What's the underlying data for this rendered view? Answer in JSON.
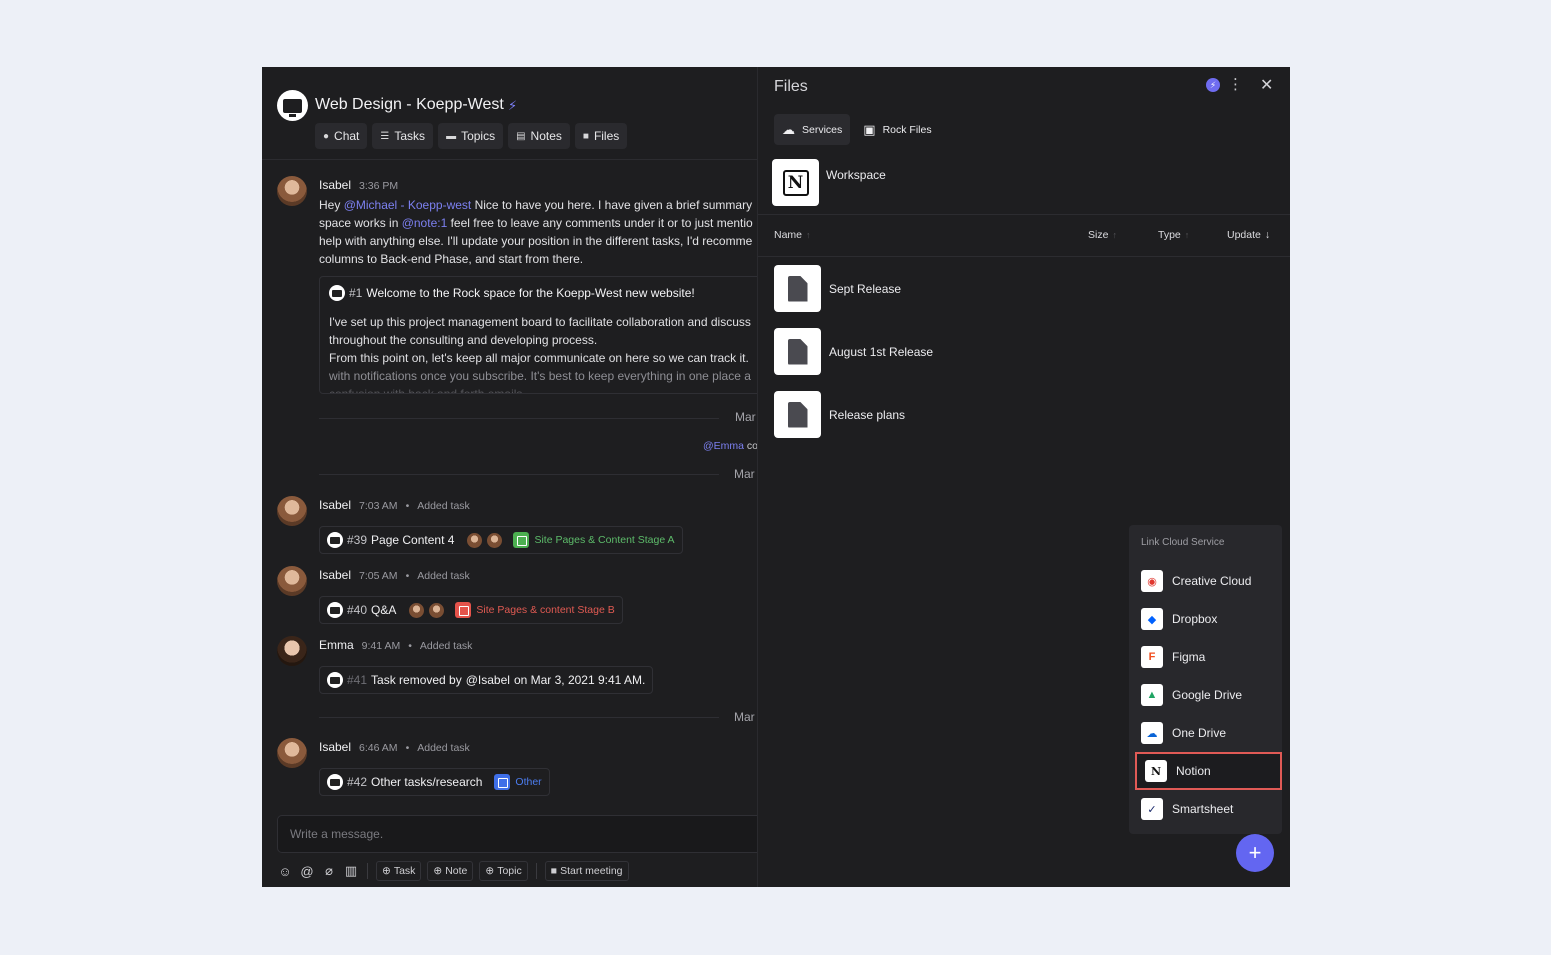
{
  "space": {
    "title": "Web Design - Koepp-West",
    "tabs": [
      {
        "label": "Chat",
        "icon": "chat-bubble-icon"
      },
      {
        "label": "Tasks",
        "icon": "tasks-icon"
      },
      {
        "label": "Topics",
        "icon": "topics-icon"
      },
      {
        "label": "Notes",
        "icon": "notes-icon"
      },
      {
        "label": "Files",
        "icon": "folder-icon"
      }
    ]
  },
  "messages": {
    "m1": {
      "name": "Isabel",
      "time": "3:36 PM",
      "line1_pre": "Hey ",
      "line1_mention": "@Michael - Koepp-west",
      "line1_post": "  Nice to have you here. I have given a brief summary",
      "line2_pre": "space works in ",
      "line2_mention": "@note:1",
      "line2_post": " feel free to leave any comments under it or to just mentio",
      "line3": "help with anything else. I'll update your position in the different tasks, I'd recomme",
      "line4": "columns to Back-end Phase, and start from there.",
      "card_num": "#1",
      "card_title": "Welcome to the Rock space for the Koepp-West new website!",
      "card_line1": "I've set up this project management board to facilitate collaboration and discuss",
      "card_line2": "throughout the consulting and developing process.",
      "card_line3": "From this point on, let's keep all major communicate on here so we can track it.",
      "card_line4": "with notifications once you subscribe. It's best to keep everything in one place a",
      "card_line5": "confusion with back and forth emails."
    },
    "date1": "Mar",
    "emma_mention": "@Emma",
    "emma_after": " co",
    "date2": "Mar",
    "m2": {
      "name": "Isabel",
      "time": "7:03 AM",
      "action": "Added task",
      "num": "#39",
      "task": "Page Content 4",
      "stage": "Site Pages & Content Stage A"
    },
    "m3": {
      "name": "Isabel",
      "time": "7:05 AM",
      "action": "Added task",
      "num": "#40",
      "task": "Q&A",
      "stage": "Site Pages & content Stage B"
    },
    "m4": {
      "name": "Emma",
      "time": "9:41 AM",
      "action": "Added task",
      "num": "#41",
      "removed_pre": "Task removed by ",
      "removed_user": "@Isabel",
      "removed_post": " on Mar 3, 2021 9:41 AM."
    },
    "date3": "Mar",
    "m5": {
      "name": "Isabel",
      "time": "6:46 AM",
      "action": "Added task",
      "num": "#42",
      "task": "Other tasks/research",
      "stage": "Other"
    },
    "dot": "•"
  },
  "composer": {
    "placeholder": "Write a message.",
    "task": "Task",
    "note": "Note",
    "topic": "Topic",
    "meeting": "Start meeting"
  },
  "files": {
    "title": "Files",
    "tabs": [
      {
        "label": "Services",
        "icon": "cloud-icon",
        "active": true
      },
      {
        "label": "Rock Files",
        "icon": "inbox-icon",
        "active": false
      }
    ],
    "workspace": "Workspace",
    "columns": {
      "name": "Name",
      "size": "Size",
      "type": "Type",
      "update": "Update"
    },
    "rows": [
      {
        "name": "Sept Release"
      },
      {
        "name": "August 1st Release"
      },
      {
        "name": "Release plans"
      }
    ]
  },
  "link_menu": {
    "title": "Link Cloud Service",
    "items": [
      {
        "label": "Creative Cloud",
        "icon": "creative-cloud-icon",
        "color": "#e0372f"
      },
      {
        "label": "Dropbox",
        "icon": "dropbox-icon",
        "color": "#0061fe"
      },
      {
        "label": "Figma",
        "icon": "figma-icon",
        "color": "#f24e1e"
      },
      {
        "label": "Google Drive",
        "icon": "google-drive-icon",
        "color": "#1fa463"
      },
      {
        "label": "One Drive",
        "icon": "onedrive-icon",
        "color": "#0a64d6"
      },
      {
        "label": "Notion",
        "icon": "notion-icon",
        "color": "#111111",
        "selected": true
      },
      {
        "label": "Smartsheet",
        "icon": "smartsheet-icon",
        "color": "#1a2a6c"
      }
    ]
  },
  "colors": {
    "accent": "#6366f1",
    "mention": "#7c80f0",
    "highlight": "#e05a56"
  }
}
